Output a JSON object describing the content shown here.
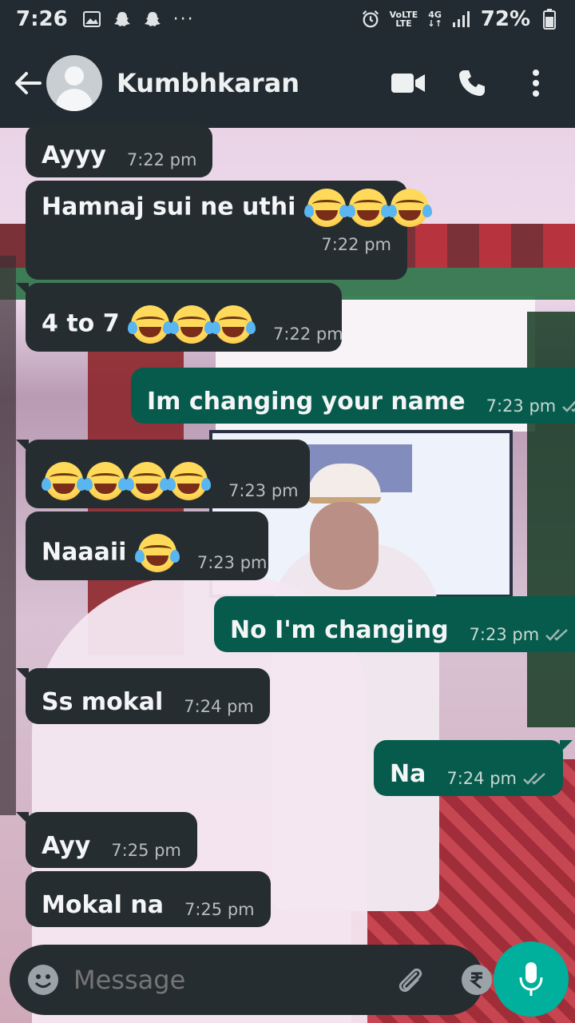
{
  "status_bar": {
    "time": "7:26",
    "left_icons": [
      "gallery-icon",
      "snapchat-icon",
      "snapchat-icon"
    ],
    "overflow": "···",
    "network": "VoLTE",
    "network_type": "4G",
    "battery_percent": "72%"
  },
  "header": {
    "contact_name": "Kumbhkaran",
    "actions": [
      "video-call-icon",
      "phone-icon",
      "more-vert-icon"
    ]
  },
  "messages": [
    {
      "dir": "in",
      "text": "Ayyy",
      "emoji_count": 0,
      "time": "7:22 pm"
    },
    {
      "dir": "in",
      "text": "Hamnaj sui ne uthi",
      "emoji_count": 3,
      "time": "7:22 pm"
    },
    {
      "dir": "in",
      "text": "4 to 7",
      "emoji_count": 3,
      "time": "7:22 pm"
    },
    {
      "dir": "out",
      "text": "Im changing your name",
      "emoji_count": 0,
      "time": "7:23 pm"
    },
    {
      "dir": "in",
      "text": "",
      "emoji_count": 4,
      "time": "7:23 pm"
    },
    {
      "dir": "in",
      "text": "Naaaii",
      "emoji_count": 1,
      "time": "7:23 pm"
    },
    {
      "dir": "out",
      "text": "No I'm changing",
      "emoji_count": 0,
      "time": "7:23 pm"
    },
    {
      "dir": "in",
      "text": "Ss mokal",
      "emoji_count": 0,
      "time": "7:24 pm"
    },
    {
      "dir": "out",
      "text": "Na",
      "emoji_count": 0,
      "time": "7:24 pm"
    },
    {
      "dir": "in",
      "text": "Ayy",
      "emoji_count": 0,
      "time": "7:25 pm"
    },
    {
      "dir": "in",
      "text": "Mokal na",
      "emoji_count": 0,
      "time": "7:25 pm"
    }
  ],
  "composer": {
    "placeholder": "Message",
    "tools": [
      "attach-icon",
      "rupee-icon",
      "camera-icon"
    ],
    "send_icon": "mic-icon"
  },
  "colors": {
    "app_bar": "#222b31",
    "incoming_bubble": "#262d31",
    "outgoing_bubble": "#065b4c",
    "fab": "#00af9c"
  }
}
